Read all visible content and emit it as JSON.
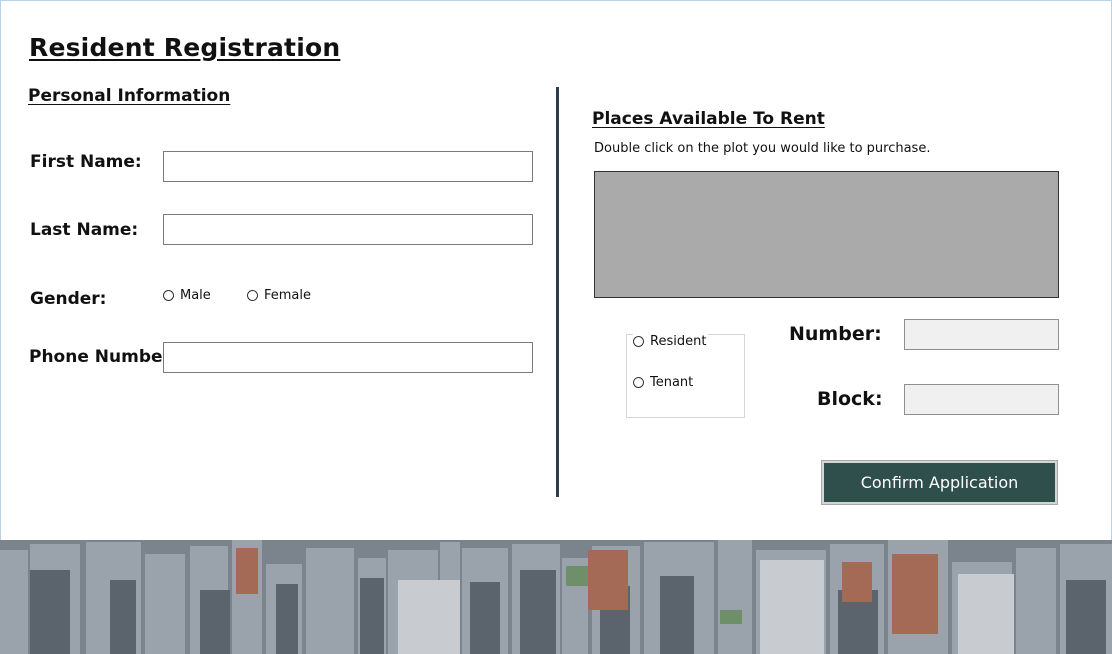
{
  "header": {
    "title": "Resident Registration"
  },
  "personal": {
    "heading": "Personal Information",
    "first_name_label": "First Name:",
    "last_name_label": "Last Name:",
    "gender_label": "Gender:",
    "gender_options": [
      "Male",
      "Female"
    ],
    "phone_label": "Phone Number",
    "first_name_value": "",
    "last_name_value": "",
    "phone_value": ""
  },
  "rent": {
    "heading": "Places Available To Rent",
    "instruction": "Double click on the plot you would like to purchase.",
    "type_options": [
      "Resident",
      "Tenant"
    ],
    "number_label": "Number:",
    "block_label": "Block:",
    "number_value": "",
    "block_value": ""
  },
  "actions": {
    "confirm_label": "Confirm Application"
  },
  "colors": {
    "accent": "#2f4f4d",
    "divider": "#2c3e4a",
    "plot_area": "#aaaaaa"
  }
}
